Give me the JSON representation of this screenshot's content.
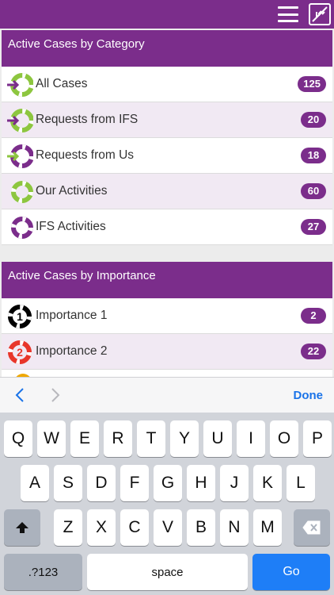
{
  "colors": {
    "brand": "#7b2d8b",
    "accent_green": "#8dc63f",
    "link_blue": "#1a73e8",
    "go_blue": "#1e7ef7"
  },
  "category_panel": {
    "title": "Active Cases by Category",
    "rows": [
      {
        "label": "All Cases",
        "count": "125",
        "icon": "lifebuoy-arrow-icon"
      },
      {
        "label": "Requests from IFS",
        "count": "20",
        "icon": "lifebuoy-arrow-icon"
      },
      {
        "label": "Requests from Us",
        "count": "18",
        "icon": "lifebuoy-arrow-icon"
      },
      {
        "label": "Our Activities",
        "count": "60",
        "icon": "lifebuoy-icon"
      },
      {
        "label": "IFS Activities",
        "count": "27",
        "icon": "lifebuoy-icon"
      }
    ]
  },
  "importance_panel": {
    "title": "Active Cases by Importance",
    "rows": [
      {
        "label": "Importance 1",
        "count": "2",
        "icon_number": "1"
      },
      {
        "label": "Importance 2",
        "count": "22",
        "icon_number": "2"
      }
    ]
  },
  "accessory": {
    "done_label": "Done"
  },
  "keyboard": {
    "row1": [
      "Q",
      "W",
      "E",
      "R",
      "T",
      "Y",
      "U",
      "I",
      "O",
      "P"
    ],
    "row2": [
      "A",
      "S",
      "D",
      "F",
      "G",
      "H",
      "J",
      "K",
      "L"
    ],
    "row3": [
      "Z",
      "X",
      "C",
      "V",
      "B",
      "N",
      "M"
    ],
    "numbers_label": ".?123",
    "space_label": "space",
    "go_label": "Go"
  }
}
